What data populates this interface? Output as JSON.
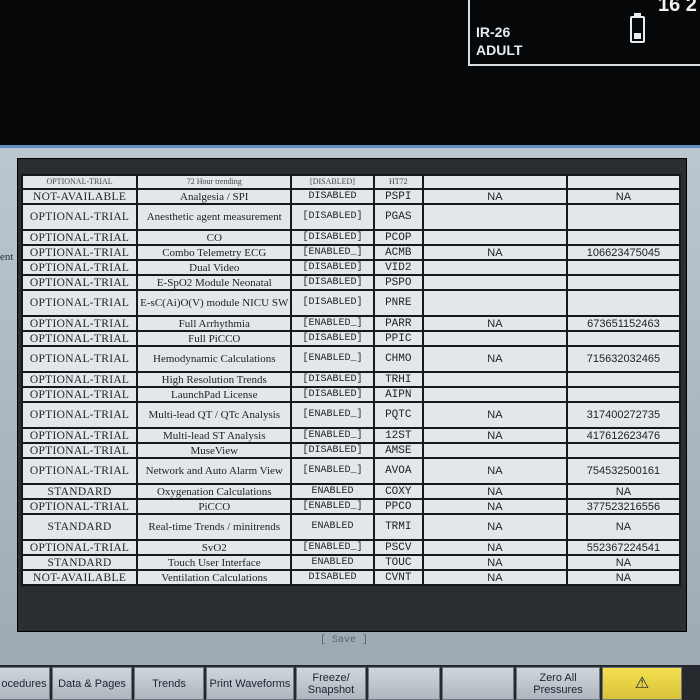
{
  "header": {
    "bed": "IR-26",
    "patient_type": "ADULT",
    "clock": "16 2"
  },
  "side_label": "ent",
  "partial_row": [
    "OPTIONAL-TRIAL",
    "72 Hour trending",
    "[DISABLED]",
    "HT72"
  ],
  "rows": [
    {
      "status": "NOT-AVAILABLE",
      "feature": "Analgesia / SPI",
      "state": "DISABLED",
      "code": "PSPI",
      "na": "NA",
      "key": "NA",
      "h": "short"
    },
    {
      "status": "OPTIONAL-TRIAL",
      "feature": "Anesthetic agent measurement",
      "state": "[DISABLED]",
      "code": "PGAS",
      "na": "",
      "key": "",
      "h": "tall"
    },
    {
      "status": "OPTIONAL-TRIAL",
      "feature": "CO",
      "state": "[DISABLED]",
      "code": "PCOP",
      "na": "",
      "key": "",
      "h": "short"
    },
    {
      "status": "OPTIONAL-TRIAL",
      "feature": "Combo Telemetry ECG",
      "state": "[ENABLED_]",
      "code": "ACMB",
      "na": "NA",
      "key": "106623475045",
      "h": "short"
    },
    {
      "status": "OPTIONAL-TRIAL",
      "feature": "Dual Video",
      "state": "[DISABLED]",
      "code": "VID2",
      "na": "",
      "key": "",
      "h": "short"
    },
    {
      "status": "OPTIONAL-TRIAL",
      "feature": "E-SpO2 Module Neonatal",
      "state": "[DISABLED]",
      "code": "PSPO",
      "na": "",
      "key": "",
      "h": "short"
    },
    {
      "status": "OPTIONAL-TRIAL",
      "feature": "E-sC(Ai)O(V) module NICU SW",
      "state": "[DISABLED]",
      "code": "PNRE",
      "na": "",
      "key": "",
      "h": "tall"
    },
    {
      "status": "OPTIONAL-TRIAL",
      "feature": "Full Arrhythmia",
      "state": "[ENABLED_]",
      "code": "PARR",
      "na": "NA",
      "key": "673651152463",
      "h": "short"
    },
    {
      "status": "OPTIONAL-TRIAL",
      "feature": "Full PiCCO",
      "state": "[DISABLED]",
      "code": "PPIC",
      "na": "",
      "key": "",
      "h": "short"
    },
    {
      "status": "OPTIONAL-TRIAL",
      "feature": "Hemodynamic Calculations",
      "state": "[ENABLED_]",
      "code": "CHMO",
      "na": "NA",
      "key": "715632032465",
      "h": "tall"
    },
    {
      "status": "OPTIONAL-TRIAL",
      "feature": "High Resolution Trends",
      "state": "[DISABLED]",
      "code": "TRHI",
      "na": "",
      "key": "",
      "h": "short"
    },
    {
      "status": "OPTIONAL-TRIAL",
      "feature": "LaunchPad License",
      "state": "[DISABLED]",
      "code": "AIPN",
      "na": "",
      "key": "",
      "h": "short"
    },
    {
      "status": "OPTIONAL-TRIAL",
      "feature": "Multi-lead QT / QTc Analysis",
      "state": "[ENABLED_]",
      "code": "PQTC",
      "na": "NA",
      "key": "317400272735",
      "h": "tall"
    },
    {
      "status": "OPTIONAL-TRIAL",
      "feature": "Multi-lead ST Analysis",
      "state": "[ENABLED_]",
      "code": "12ST",
      "na": "NA",
      "key": "417612623476",
      "h": "short"
    },
    {
      "status": "OPTIONAL-TRIAL",
      "feature": "MuseView",
      "state": "[DISABLED]",
      "code": "AMSE",
      "na": "",
      "key": "",
      "h": "short"
    },
    {
      "status": "OPTIONAL-TRIAL",
      "feature": "Network and Auto Alarm View",
      "state": "[ENABLED_]",
      "code": "AVOA",
      "na": "NA",
      "key": "754532500161",
      "h": "tall"
    },
    {
      "status": "STANDARD",
      "feature": "Oxygenation Calculations",
      "state": "ENABLED",
      "code": "COXY",
      "na": "NA",
      "key": "NA",
      "h": "short"
    },
    {
      "status": "OPTIONAL-TRIAL",
      "feature": "PiCCO",
      "state": "[ENABLED_]",
      "code": "PPCO",
      "na": "NA",
      "key": "377523216556",
      "h": "short"
    },
    {
      "status": "STANDARD",
      "feature": "Real-time Trends / minitrends",
      "state": "ENABLED",
      "code": "TRMI",
      "na": "NA",
      "key": "NA",
      "h": "tall"
    },
    {
      "status": "OPTIONAL-TRIAL",
      "feature": "SvO2",
      "state": "[ENABLED_]",
      "code": "PSCV",
      "na": "NA",
      "key": "552367224541",
      "h": "short"
    },
    {
      "status": "STANDARD",
      "feature": "Touch User Interface",
      "state": "ENABLED",
      "code": "TOUC",
      "na": "NA",
      "key": "NA",
      "h": "short"
    },
    {
      "status": "NOT-AVAILABLE",
      "feature": "Ventilation Calculations",
      "state": "DISABLED",
      "code": "CVNT",
      "na": "NA",
      "key": "NA",
      "h": "short"
    }
  ],
  "save_label": "[ Save ]",
  "bottom_bar": {
    "procedures": "ocedures",
    "data_pages": "Data & Pages",
    "trends": "Trends",
    "print_waveforms": "Print Waveforms",
    "freeze_snapshot": "Freeze/ Snapshot",
    "zero_all": "Zero All Pressures",
    "alarm_icon": "⚠"
  }
}
